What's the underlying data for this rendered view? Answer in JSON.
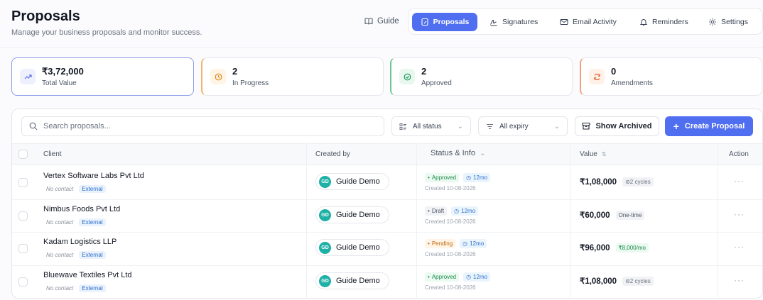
{
  "header": {
    "title": "Proposals",
    "subtitle": "Manage your business proposals and monitor success."
  },
  "nav": {
    "guide": "Guide",
    "proposals": "Proposals",
    "signatures": "Signatures",
    "email_activity": "Email Activity",
    "reminders": "Reminders",
    "settings": "Settings"
  },
  "stats": [
    {
      "value": "₹3,72,000",
      "label": "Total Value",
      "accent": "#5b6ee8",
      "bg": "#eef0fd",
      "icon": "trend-up-icon"
    },
    {
      "value": "2",
      "label": "In Progress",
      "accent": "#e08a1e",
      "bg": "#fff4e5",
      "icon": "clock-icon"
    },
    {
      "value": "2",
      "label": "Approved",
      "accent": "#1f9a5c",
      "bg": "#e8f8ef",
      "icon": "check-circle-icon"
    },
    {
      "value": "0",
      "label": "Amendments",
      "accent": "#e4612a",
      "bg": "#fff0e8",
      "icon": "refresh-icon"
    }
  ],
  "toolbar": {
    "search_placeholder": "Search proposals...",
    "status_filter": "All status",
    "expiry_filter": "All expiry",
    "show_archived": "Show Archived",
    "create": "Create Proposal"
  },
  "table": {
    "columns": {
      "client": "Client",
      "created_by": "Created by",
      "status": "Status & Info",
      "value": "Value",
      "action": "Action"
    },
    "rows": [
      {
        "client": "Vertex Software Labs Pvt Ltd",
        "contact": "No contact",
        "tag": "External",
        "creator": "Guide Demo",
        "initials": "GD",
        "status": "Approved",
        "status_type": "approved",
        "duration": "12mo",
        "created": "Created 10-08-2026",
        "value": "₹1,08,000",
        "badge": "2 cycles",
        "badge_type": "cycles"
      },
      {
        "client": "Nimbus Foods Pvt Ltd",
        "contact": "No contact",
        "tag": "External",
        "creator": "Guide Demo",
        "initials": "GD",
        "status": "Draft",
        "status_type": "draft",
        "duration": "12mo",
        "created": "Created 10-08-2026",
        "value": "₹60,000",
        "badge": "One-time",
        "badge_type": "onetime"
      },
      {
        "client": "Kadam Logistics LLP",
        "contact": "No contact",
        "tag": "External",
        "creator": "Guide Demo",
        "initials": "GD",
        "status": "Pending",
        "status_type": "pending",
        "duration": "12mo",
        "created": "Created 10-08-2026",
        "value": "₹96,000",
        "badge": "₹8,000/mo",
        "badge_type": "monthly"
      },
      {
        "client": "Bluewave Textiles Pvt Ltd",
        "contact": "No contact",
        "tag": "External",
        "creator": "Guide Demo",
        "initials": "GD",
        "status": "Approved",
        "status_type": "approved",
        "duration": "12mo",
        "created": "Created 10-08-2026",
        "value": "₹1,08,000",
        "badge": "2 cycles",
        "badge_type": "cycles"
      }
    ]
  }
}
